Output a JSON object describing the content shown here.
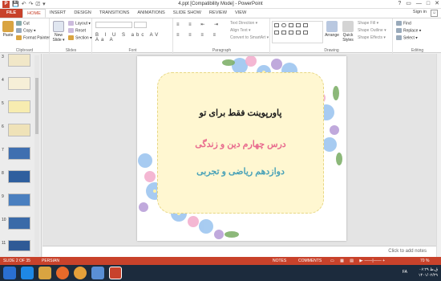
{
  "window": {
    "title": "4.ppt [Compatibility Mode] - PowerPoint",
    "controls": [
      "?",
      "▭",
      "—",
      "□",
      "✕"
    ]
  },
  "qat": {
    "logo": "P",
    "save": "💾",
    "undo": "↶",
    "redo": "↷",
    "start": "⎚",
    "more": "▾"
  },
  "tabs": [
    "FILE",
    "HOME",
    "INSERT",
    "DESIGN",
    "TRANSITIONS",
    "ANIMATIONS",
    "SLIDE SHOW",
    "REVIEW",
    "VIEW"
  ],
  "signin": "Sign in",
  "ribbon": {
    "clipboard": {
      "label": "Clipboard",
      "paste": "Paste",
      "cut": "Cut",
      "copy": "Copy ▾",
      "format_painter": "Format Painter"
    },
    "slides": {
      "label": "Slides",
      "new_slide": "New Slide ▾",
      "layout": "Layout ▾",
      "reset": "Reset",
      "section": "Section ▾"
    },
    "font": {
      "label": "Font",
      "format_row": "B I U S abc AV Aa A"
    },
    "paragraph": {
      "label": "Paragraph",
      "text_direction": "Text Direction ▾",
      "align_text": "Align Text ▾",
      "convert_smartart": "Convert to SmartArt ▾"
    },
    "drawing": {
      "label": "Drawing",
      "arrange": "Arrange",
      "quick_styles": "Quick Styles",
      "shape_fill": "Shape Fill ▾",
      "shape_outline": "Shape Outline ▾",
      "shape_effects": "Shape Effects ▾"
    },
    "editing": {
      "label": "Editing",
      "find": "Find",
      "replace": "Replace ▾",
      "select": "Select ▾"
    }
  },
  "thumbnails": [
    {
      "num": "3",
      "bg": "#f1e7c8"
    },
    {
      "num": "4",
      "bg": "#f6efd7"
    },
    {
      "num": "5",
      "bg": "#f7ecb0"
    },
    {
      "num": "6",
      "bg": "#efe2b8"
    },
    {
      "num": "7",
      "bg": "#3f6fb0"
    },
    {
      "num": "8",
      "bg": "#2f5f9e"
    },
    {
      "num": "9",
      "bg": "#4a7fbf"
    },
    {
      "num": "10",
      "bg": "#3a6aa8"
    },
    {
      "num": "11",
      "bg": "#2f5a96"
    }
  ],
  "slide": {
    "title": "پاورپوینت فقط برای تو",
    "subtitle1": "درس چهارم دین و زندگی",
    "subtitle2": "دوازدهم ریاضی و تجربی"
  },
  "notes": {
    "placeholder": "Click to add notes"
  },
  "status": {
    "slide": "SLIDE 2 OF 35",
    "language": "PERSIAN",
    "notes": "NOTES",
    "comments": "COMMENTS",
    "zoom": "70 %"
  },
  "taskbar": {
    "time": "۰۶:۲۹ ق.ظ",
    "date": "۱۴۰۱/۰۲/۲۹",
    "lang": "FA"
  },
  "colors": {
    "accent": "#c8422b",
    "taskbar": "#1c2b3d",
    "frame": "#fff7d1",
    "subtitle_pink": "#e86a8e",
    "subtitle_teal": "#4aa2b8"
  }
}
